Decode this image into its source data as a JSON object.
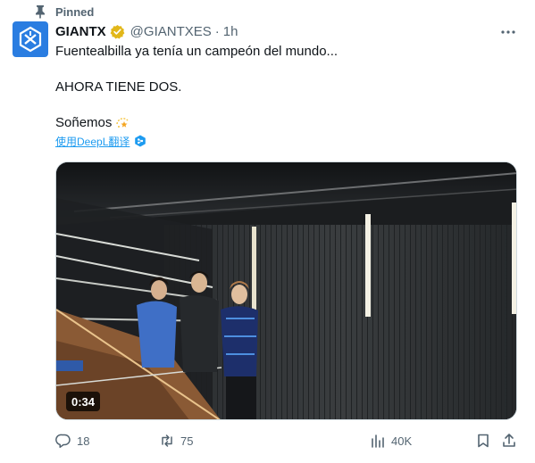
{
  "pinned": {
    "label": "Pinned"
  },
  "author": {
    "display_name": "GIANTX",
    "handle": "@GIANTXES",
    "separator": "·",
    "time": "1h"
  },
  "tweet": {
    "line1": "Fuentealbilla ya tenía un campeón del mundo...",
    "line2": "AHORA TIENE DOS.",
    "line3": "Soñemos"
  },
  "translate": {
    "label": "使用DeepL翻译"
  },
  "media": {
    "duration": "0:34"
  },
  "actions": {
    "replies": "18",
    "retweets": "75",
    "views": "40K"
  },
  "colors": {
    "accent": "#1d9bf0",
    "secondary_text": "#536471",
    "verified_gold": "#e2b719",
    "avatar_bg": "#2a7de1"
  },
  "icons": {
    "pin": "pin-icon",
    "verified": "verified-badge-icon",
    "more": "more-dots-icon",
    "reply": "reply-icon",
    "retweet": "retweet-icon",
    "views": "views-chart-icon",
    "bookmark": "bookmark-icon",
    "share": "share-icon",
    "deepl": "deepl-icon",
    "emoji": "sparkle-emoji"
  }
}
